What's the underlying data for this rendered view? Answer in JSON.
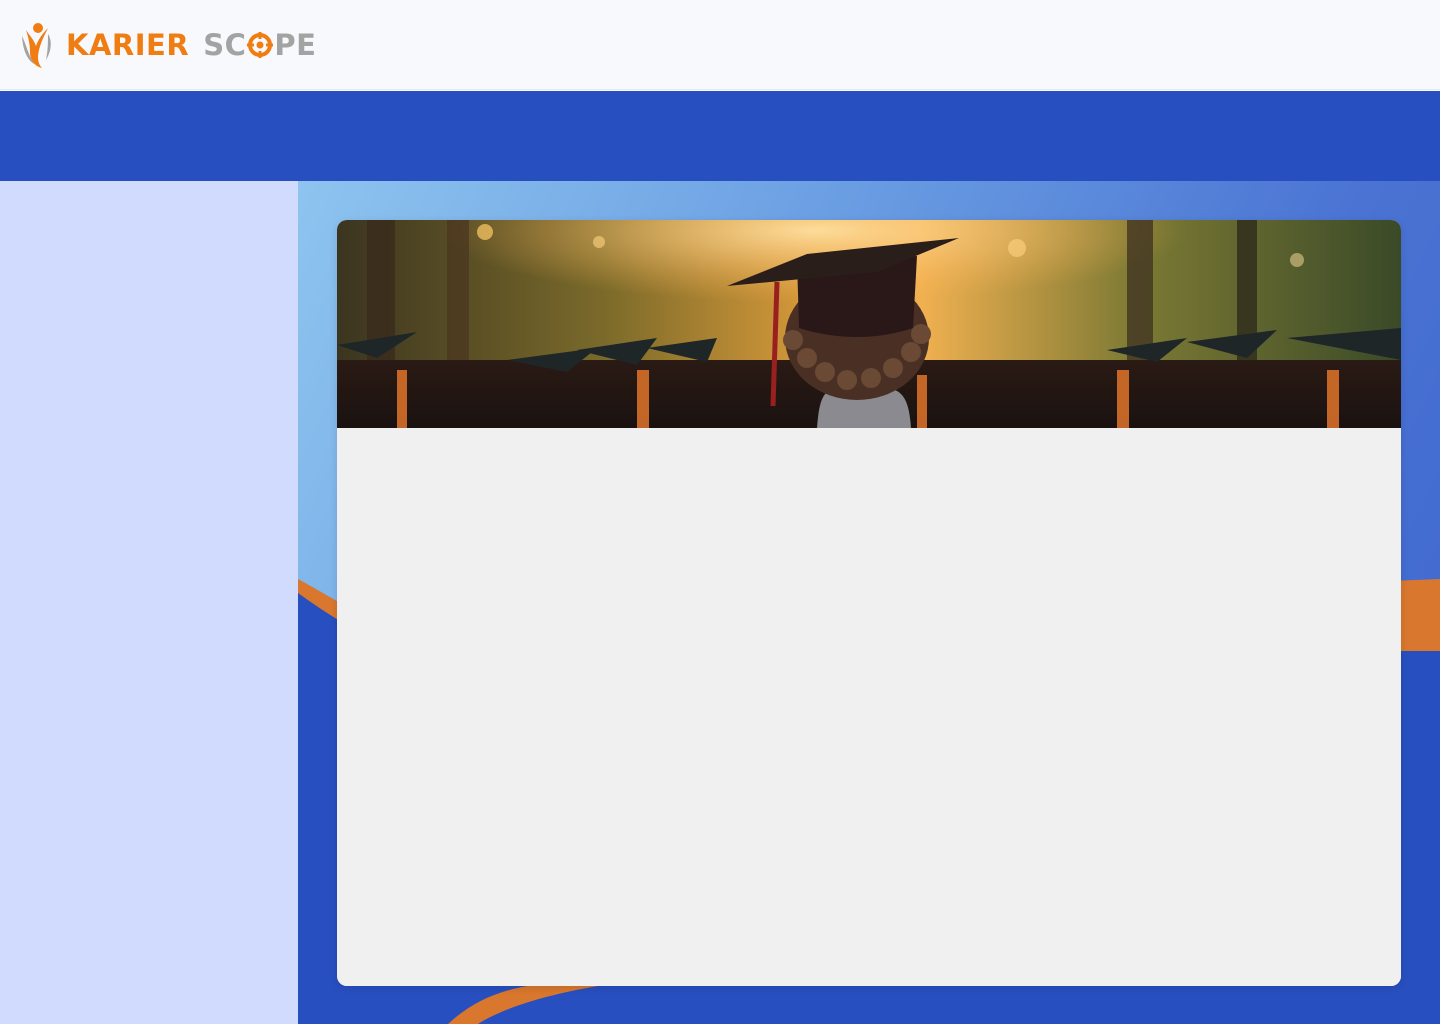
{
  "brand": {
    "name_part1": "KARIER",
    "name_part2_before_o": "SC",
    "name_part2_after_o": "PE",
    "primary_color": "#f07d12",
    "secondary_color": "#a3a3a3"
  },
  "theme": {
    "nav_band_color": "#284fc0",
    "sidebar_color": "#d1dbfd",
    "accent_orange": "#d9772e"
  },
  "hero": {
    "image": "graduation-ceremony-photo"
  }
}
